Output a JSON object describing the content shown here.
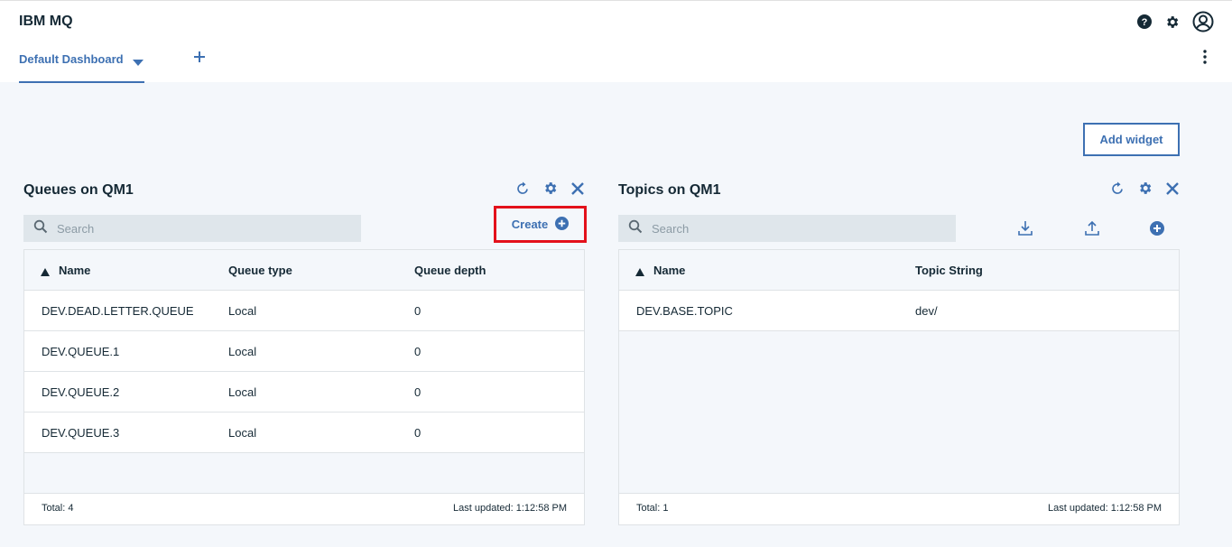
{
  "app": {
    "title": "IBM MQ"
  },
  "tabs": [
    {
      "label": "Default Dashboard"
    }
  ],
  "toolbar": {
    "add_widget_label": "Add widget"
  },
  "colors": {
    "accent": "#3d70b2",
    "highlight": "#e3111b",
    "background": "#f4f7fb"
  },
  "icons": [
    "help-icon",
    "settings-icon",
    "user-avatar-icon",
    "caret-down-icon",
    "add-icon",
    "overflow-menu-icon",
    "refresh-icon",
    "gear-icon",
    "close-icon",
    "search-icon",
    "add-circle-icon",
    "download-icon",
    "upload-icon"
  ],
  "queues_widget": {
    "title": "Queues on QM1",
    "search_placeholder": "Search",
    "create_label": "Create",
    "columns": [
      "Name",
      "Queue type",
      "Queue depth"
    ],
    "rows": [
      {
        "name": "DEV.DEAD.LETTER.QUEUE",
        "type": "Local",
        "depth": "0"
      },
      {
        "name": "DEV.QUEUE.1",
        "type": "Local",
        "depth": "0"
      },
      {
        "name": "DEV.QUEUE.2",
        "type": "Local",
        "depth": "0"
      },
      {
        "name": "DEV.QUEUE.3",
        "type": "Local",
        "depth": "0"
      }
    ],
    "total": "Total: 4",
    "last_updated": "Last updated: 1:12:58 PM"
  },
  "topics_widget": {
    "title": "Topics on QM1",
    "search_placeholder": "Search",
    "columns": [
      "Name",
      "Topic String"
    ],
    "rows": [
      {
        "name": "DEV.BASE.TOPIC",
        "topic_string": "dev/"
      }
    ],
    "total": "Total: 1",
    "last_updated": "Last updated: 1:12:58 PM"
  }
}
